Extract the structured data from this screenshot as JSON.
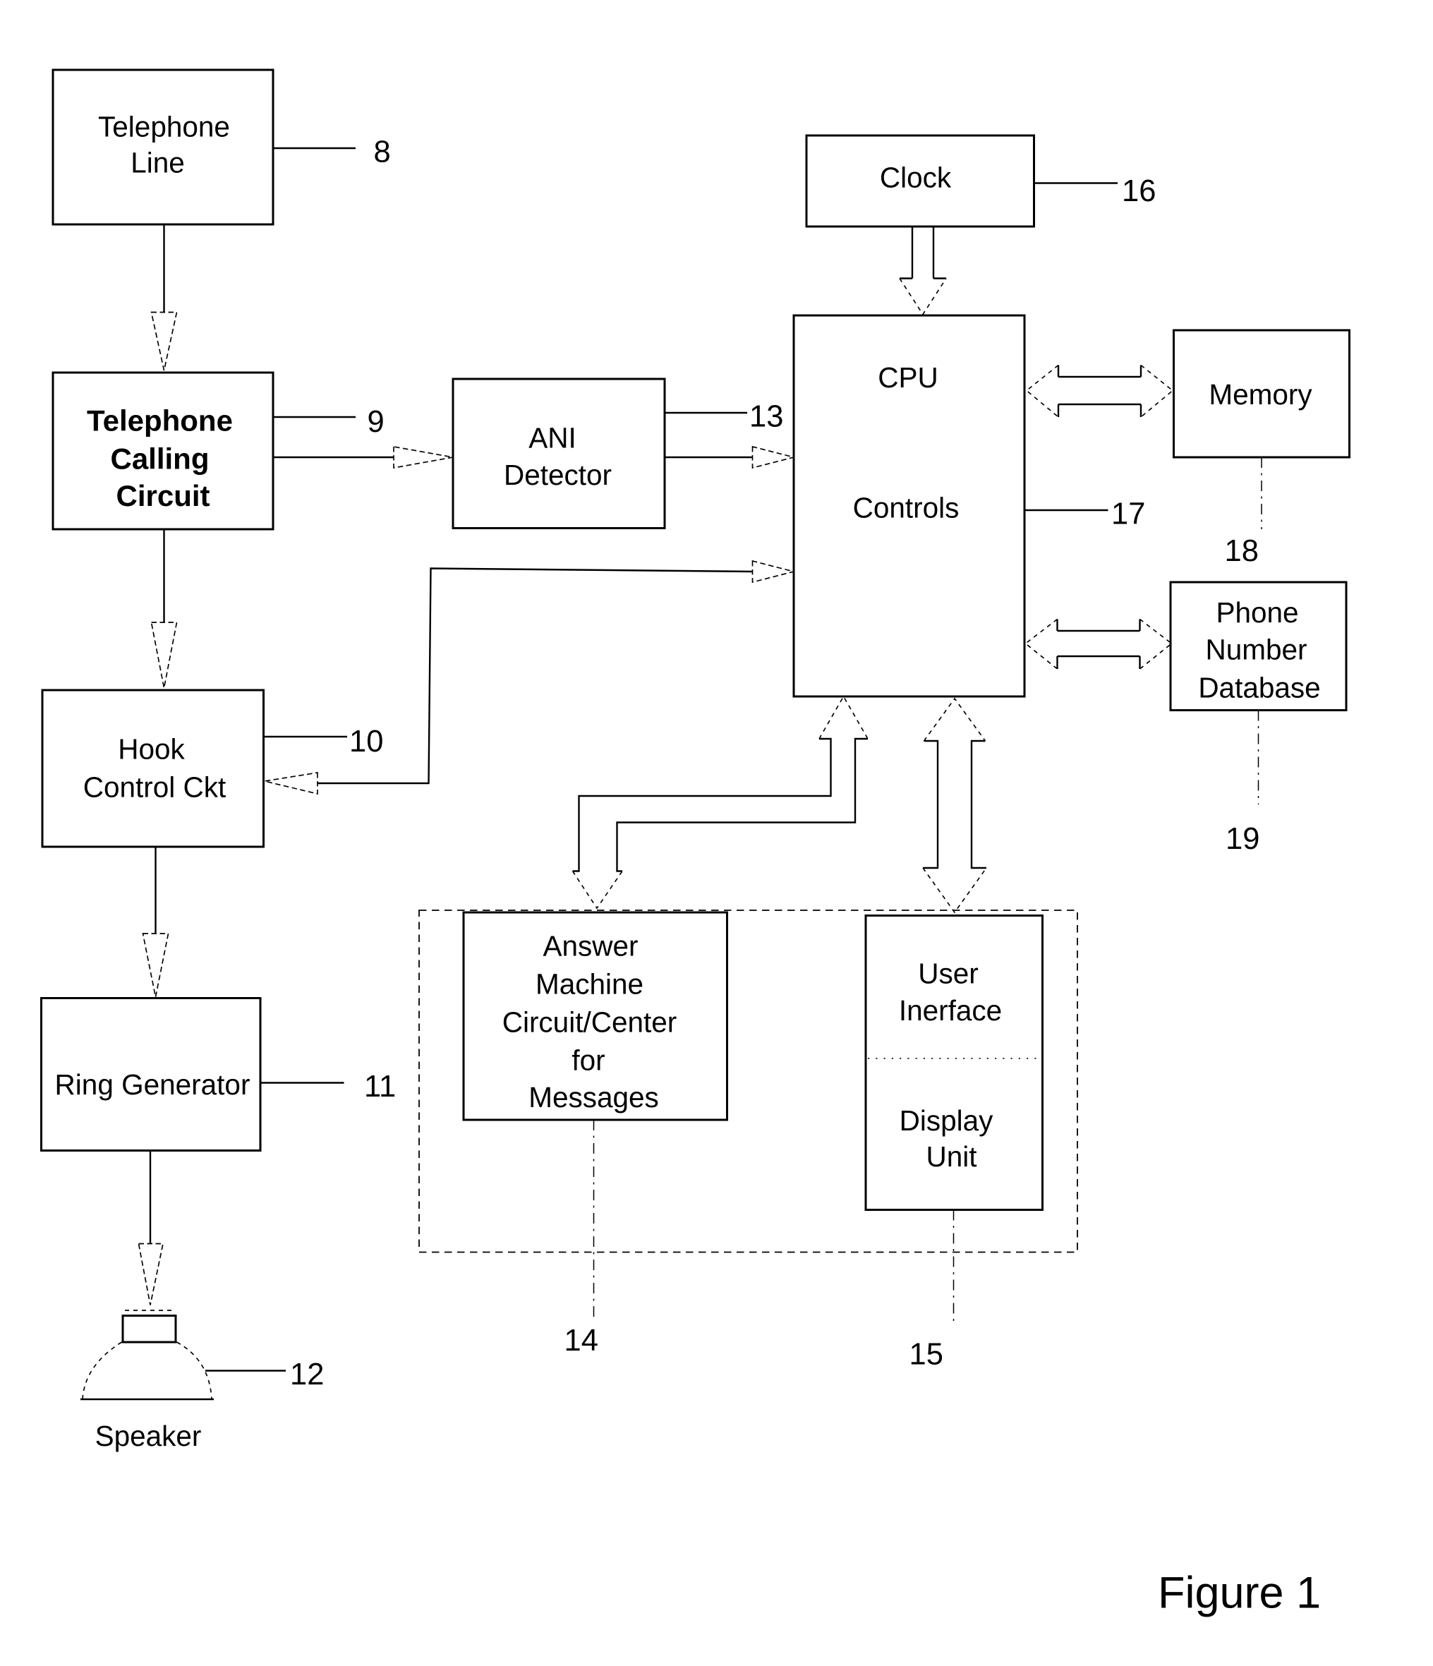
{
  "figure_label": "Figure 1",
  "blocks": {
    "telephone_line": {
      "lines": [
        "Telephone",
        "Line"
      ],
      "ref": "8"
    },
    "telephone_calling_circuit": {
      "lines": [
        "Telephone",
        "Calling",
        "Circuit"
      ],
      "ref": "9"
    },
    "hook_control": {
      "lines": [
        "Hook",
        "Control Ckt"
      ],
      "ref": "10"
    },
    "ring_generator": {
      "lines": [
        "Ring Generator"
      ],
      "ref": "11"
    },
    "speaker": {
      "lines": [
        "Speaker"
      ],
      "ref": "12"
    },
    "ani_detector": {
      "lines": [
        "ANI",
        "Detector"
      ],
      "ref": "13"
    },
    "answer_machine": {
      "lines": [
        "Answer",
        "Machine",
        "Circuit/Center",
        "for",
        "Messages"
      ],
      "ref": "14"
    },
    "user_interface_display": {
      "upper_lines": [
        "User",
        "Inerface"
      ],
      "lower_lines": [
        "Display",
        "Unit"
      ],
      "ref": "15"
    },
    "clock": {
      "lines": [
        "Clock"
      ],
      "ref": "16"
    },
    "cpu": {
      "lines": [
        "CPU",
        "Controls"
      ],
      "ref": "17"
    },
    "memory": {
      "lines": [
        "Memory"
      ],
      "ref": "18"
    },
    "phone_number_database": {
      "lines": [
        "Phone",
        "Number",
        "Database"
      ],
      "ref": "19"
    }
  },
  "connections": [
    {
      "from": "Telephone Line",
      "to": "Telephone Calling Circuit",
      "type": "single-arrow"
    },
    {
      "from": "Telephone Calling Circuit",
      "to": "ANI Detector",
      "type": "single-arrow"
    },
    {
      "from": "Telephone Calling Circuit",
      "to": "Hook Control Ckt",
      "type": "single-arrow"
    },
    {
      "from": "ANI Detector",
      "to": "CPU Controls",
      "type": "single-arrow"
    },
    {
      "from": "Hook Control Ckt",
      "to": "CPU Controls",
      "type": "single-arrow"
    },
    {
      "from": "CPU Controls",
      "to": "Hook Control Ckt",
      "type": "single-arrow"
    },
    {
      "from": "Hook Control Ckt",
      "to": "Ring Generator",
      "type": "single-arrow"
    },
    {
      "from": "Ring Generator",
      "to": "Speaker",
      "type": "single-arrow"
    },
    {
      "from": "Clock",
      "to": "CPU Controls",
      "type": "bus-arrow"
    },
    {
      "from": "CPU Controls",
      "to": "Memory",
      "type": "bidirectional-bus"
    },
    {
      "from": "CPU Controls",
      "to": "Phone Number Database",
      "type": "bidirectional-bus"
    },
    {
      "from": "CPU Controls",
      "to": "Answer Machine Circuit/Center for Messages",
      "type": "bidirectional-bus"
    },
    {
      "from": "CPU Controls",
      "to": "User Interface / Display Unit",
      "type": "bidirectional-bus"
    }
  ]
}
